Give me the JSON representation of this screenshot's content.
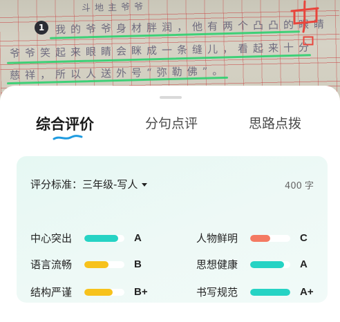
{
  "photo": {
    "title_line": "斗地主爷爷",
    "line1": "我的爷爷身材胖润，他有两个凸凸的眼睛",
    "line2": "爷爷笑起来眼睛会眯成一条缝儿，看起来十分",
    "line3": "慈祥，所以人送外号“弥勒佛”。",
    "marker": "1"
  },
  "tabs": [
    {
      "label": "综合评价",
      "active": true
    },
    {
      "label": "分句点评",
      "active": false
    },
    {
      "label": "思路点拨",
      "active": false
    }
  ],
  "card": {
    "standard_label": "评分标准：三年级-写人",
    "word_count": "400 字"
  },
  "scores": [
    {
      "name": "中心突出",
      "grade": "A",
      "level": 0.85,
      "color": "#26d3c4"
    },
    {
      "name": "人物鲜明",
      "grade": "C",
      "level": 0.5,
      "color": "#f47a62"
    },
    {
      "name": "语言流畅",
      "grade": "B",
      "level": 0.6,
      "color": "#f7c21c"
    },
    {
      "name": "思想健康",
      "grade": "A",
      "level": 0.85,
      "color": "#26d3c4"
    },
    {
      "name": "结构严谨",
      "grade": "B+",
      "level": 0.7,
      "color": "#f7c21c"
    },
    {
      "name": "书写规范",
      "grade": "A+",
      "level": 1.0,
      "color": "#26d3c4"
    }
  ],
  "colors": {
    "accent": "#2fc3b0",
    "tab_underline": "#1e9be0",
    "correction_red": "#e8453c",
    "highlight_green": "#2ecf6f"
  }
}
